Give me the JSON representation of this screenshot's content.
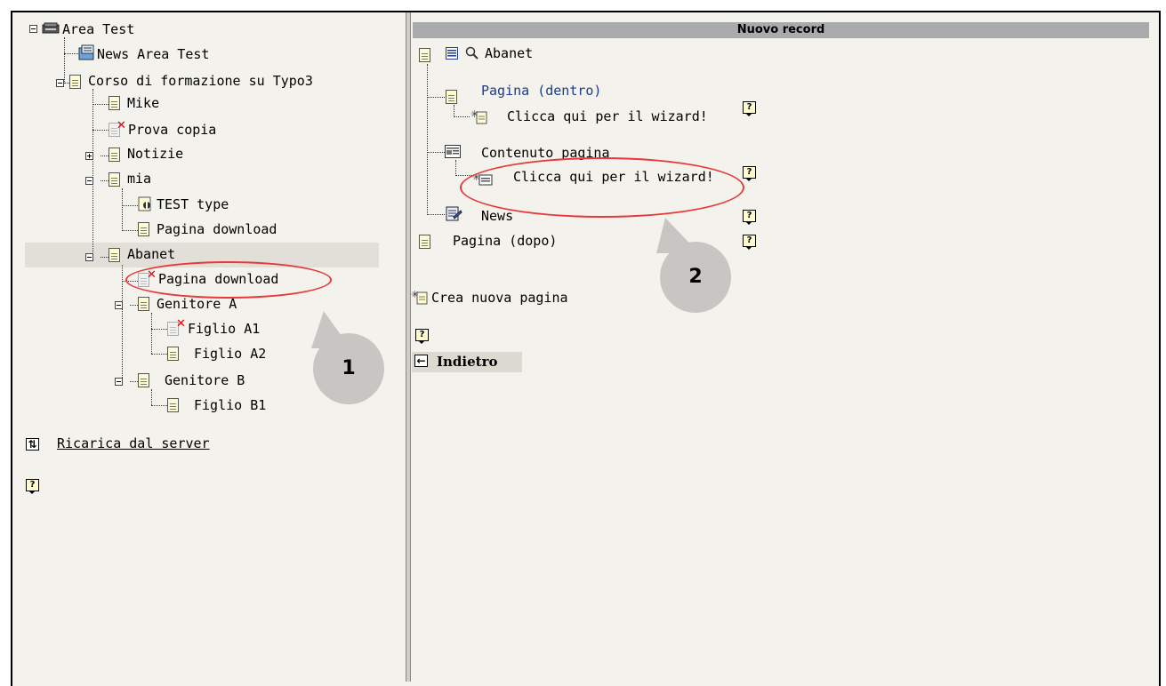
{
  "tree": {
    "root": "Area Test",
    "items": {
      "news_area_test": "News Area Test",
      "corso": "Corso di formazione su Typo3",
      "mike": "Mike",
      "prova_copia": "Prova copia",
      "notizie": "Notizie",
      "mia": "mia",
      "test_type": "TEST type",
      "pagina_download_1": "Pagina download",
      "abanet": "Abanet",
      "pagina_download_2": "Pagina download",
      "genitore_a": "Genitore A",
      "figlio_a1": "Figlio A1",
      "figlio_a2": "Figlio A2",
      "genitore_b": "Genitore B",
      "figlio_b1": "Figlio B1"
    },
    "reload": "Ricarica dal server",
    "help_icon": "?"
  },
  "panel": {
    "header": "Nuovo record",
    "current_page": "Abanet",
    "pagina_dentro": "Pagina (dentro)",
    "wizard_1": "Clicca qui per il wizard!",
    "contenuto": "Contenuto pagina",
    "wizard_2": "Clicca qui per il wizard!",
    "news": "News",
    "pagina_dopo": "Pagina (dopo)",
    "crea_nuova": "Crea nuova pagina",
    "back": "Indietro",
    "help_icon": "?"
  },
  "callouts": {
    "one": "1",
    "two": "2"
  },
  "colors": {
    "panel_bg": "#f4f2ec",
    "header_bg": "#a8aaac",
    "highlight_row": "#e1dfd8",
    "annotation_red": "#e63a3a",
    "callout_gray": "#c8c6c3",
    "link_blue": "#1a3c8a"
  }
}
